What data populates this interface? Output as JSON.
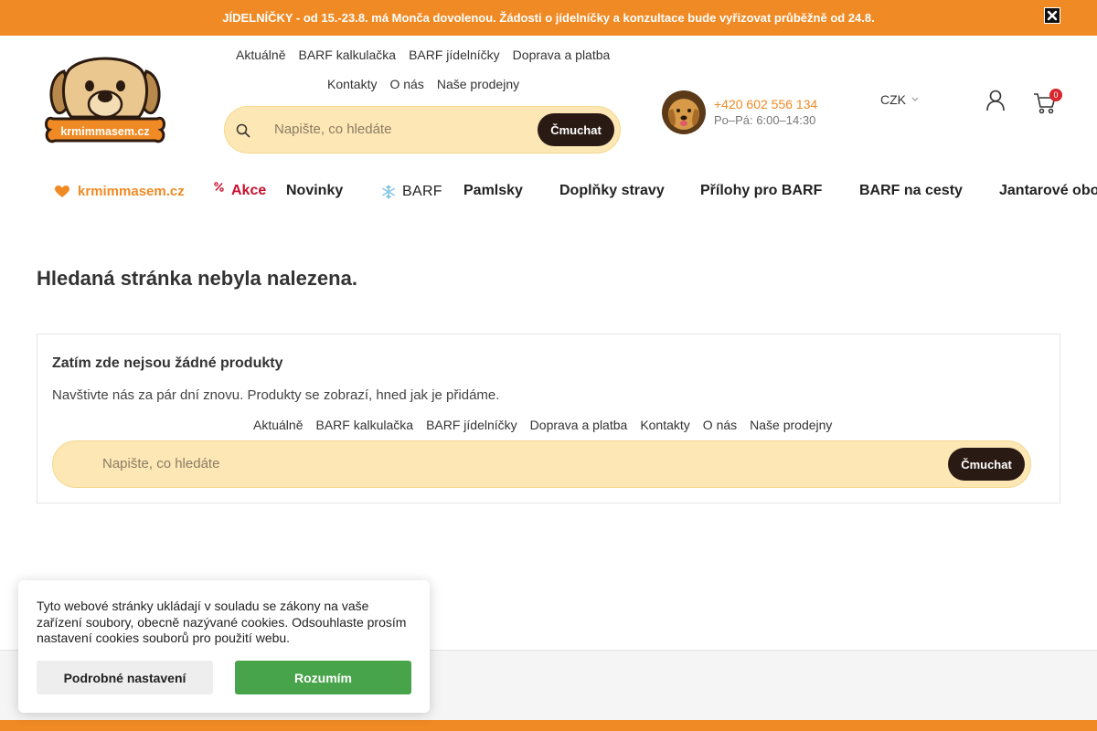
{
  "announcement": "JÍDELNÍČKY - od 15.-23.8. má Monča dovolenou. Žádosti o jídelníčky a konzultace bude vyřizovat průběžně od 24.8.",
  "logo": {
    "text": "krmimmasem.cz"
  },
  "top_nav": {
    "row1": [
      "Aktuálně",
      "BARF kalkulačka",
      "BARF jídelníčky",
      "Doprava a platba"
    ],
    "row2": [
      "Kontakty",
      "O nás",
      "Naše prodejny"
    ]
  },
  "search": {
    "placeholder": "Napište, co hledáte",
    "button": "Čmuchat"
  },
  "contact": {
    "phone": "+420 602 556 134",
    "hours": "Po–Pá: 6:00–14:30"
  },
  "currency": "CZK",
  "cart": {
    "count": "0"
  },
  "categories": [
    "krmimmasem.cz",
    "Akce",
    "Novinky",
    "BARF",
    "Pamlsky",
    "Doplňky stravy",
    "Přílohy pro BARF",
    "BARF na cesty",
    "Jantarové obo"
  ],
  "page": {
    "title": "Hledaná stránka nebyla nalezena.",
    "empty_title": "Zatím zde nejsou žádné produkty",
    "empty_text": "Navštivte nás za pár dní znovu. Produkty se zobrazí, hned jak je přidáme.",
    "nav": [
      "Aktuálně",
      "BARF kalkulačka",
      "BARF jídelníčky",
      "Doprava a platba",
      "Kontakty",
      "O nás",
      "Naše prodejny"
    ]
  },
  "cookie": {
    "text": "Tyto webové stránky ukládají v souladu se zákony na vaše zařízení soubory, obecně nazývané cookies. Odsouhlaste prosím nastavení cookies souborů pro použití webu.",
    "settings": "Podrobné nastavení",
    "accept": "Rozumím"
  },
  "colors": {
    "brand_orange": "#f08a24",
    "search_bg": "#fde7b4",
    "button_dark": "#2a1a14",
    "accept_green": "#48a44a",
    "sale_red": "#c8102e",
    "barf_blue": "#7fc6ea"
  },
  "icons": [
    "close-icon",
    "search-icon",
    "user-icon",
    "cart-icon",
    "heart-icon",
    "percent-icon",
    "snowflake-icon",
    "chevron-down-icon"
  ]
}
